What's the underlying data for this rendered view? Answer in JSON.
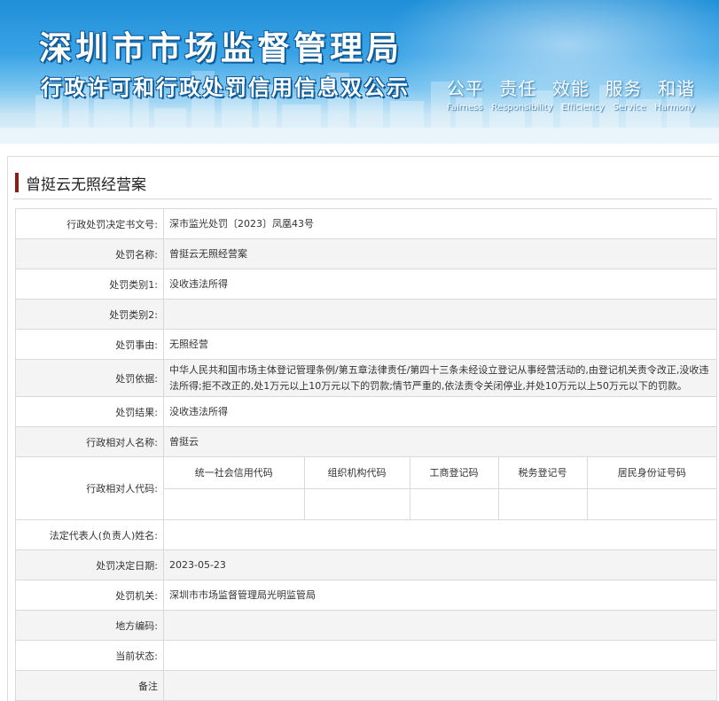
{
  "header": {
    "title": "深圳市市场监督管理局",
    "subtitle": "行政许可和行政处罚信用信息双公示",
    "slogans_cn": [
      "公平",
      "责任",
      "效能",
      "服务",
      "和谐"
    ],
    "slogans_en": [
      "Fairness",
      "Responsibility",
      "Efficiency",
      "Service",
      "Harmony"
    ]
  },
  "case": {
    "title": "曾挺云无照经营案"
  },
  "fields": {
    "decision_no": {
      "label": "行政处罚决定书文号:",
      "value": "深市监光处罚〔2023〕凤凰43号"
    },
    "penalty_name": {
      "label": "处罚名称:",
      "value": "曾挺云无照经营案"
    },
    "category1": {
      "label": "处罚类别1:",
      "value": "没收违法所得"
    },
    "category2": {
      "label": "处罚类别2:",
      "value": ""
    },
    "reason": {
      "label": "处罚事由:",
      "value": "无照经营"
    },
    "basis": {
      "label": "处罚依据:",
      "value": "中华人民共和国市场主体登记管理条例/第五章法律责任/第四十三条未经设立登记从事经营活动的,由登记机关责令改正,没收违法所得;拒不改正的,处1万元以上10万元以下的罚款;情节严重的,依法责令关闭停业,并处10万元以上50万元以下的罚款。"
    },
    "result": {
      "label": "处罚结果:",
      "value": "没收违法所得"
    },
    "party_name": {
      "label": "行政相对人名称:",
      "value": "曾挺云"
    },
    "party_code": {
      "label": "行政相对人代码:",
      "columns": [
        "统一社会信用代码",
        "组织机构代码",
        "工商登记码",
        "税务登记号",
        "居民身份证号码"
      ],
      "values": [
        "",
        "",
        "",
        "",
        ""
      ]
    },
    "legal_rep": {
      "label": "法定代表人(负责人)姓名:",
      "value": ""
    },
    "decision_date": {
      "label": "处罚决定日期:",
      "value": "2023-05-23"
    },
    "authority": {
      "label": "处罚机关:",
      "value": "深圳市市场监督管理局光明监管局"
    },
    "local_code": {
      "label": "地方编码:",
      "value": ""
    },
    "status": {
      "label": "当前状态:",
      "value": ""
    },
    "remarks": {
      "label": "备注",
      "value": ""
    }
  },
  "colors": {
    "accent": "#8e1b14",
    "banner_blue": "#1f8fd8",
    "row_alt": "#f4f4f4",
    "border": "#d9d9d9"
  }
}
